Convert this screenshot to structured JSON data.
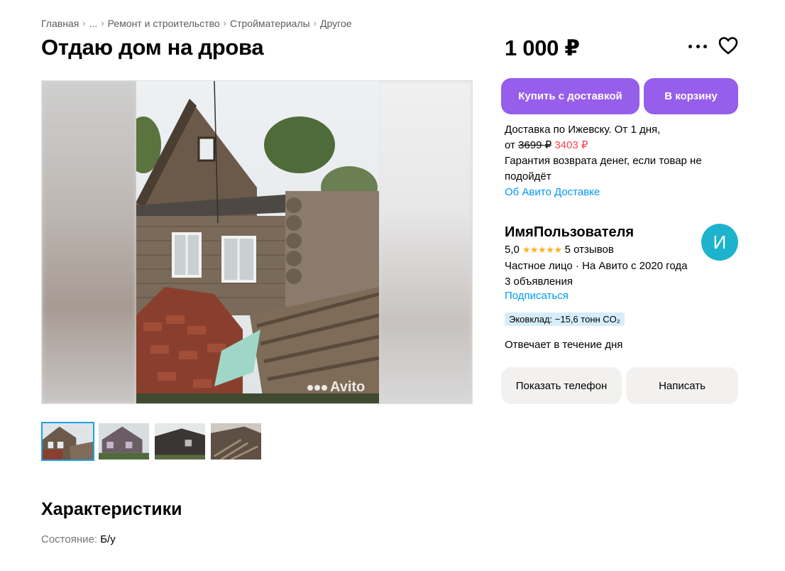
{
  "breadcrumb": {
    "items": [
      "Главная",
      "...",
      "Ремонт и строительство",
      "Стройматериалы",
      "Другое"
    ],
    "separator": "›"
  },
  "title": "Отдаю дом на дрова",
  "gallery": {
    "watermark": "Avito",
    "thumbnail_count": 4,
    "active_thumbnail": 1
  },
  "characteristics": {
    "heading": "Характеристики",
    "condition_label": "Состояние:",
    "condition_value": "Б/у"
  },
  "price": "1 000 ₽",
  "actions": {
    "buy_with_delivery": "Купить с доставкой",
    "add_to_cart": "В корзину",
    "more_icon": "more-dots-icon",
    "favorite_icon": "heart-icon"
  },
  "delivery": {
    "line1": "Доставка по Ижевску. От 1 дня,",
    "from_prefix": "от",
    "old_price": "3699 ₽",
    "new_price": "3403 ₽",
    "guarantee": "Гарантия возврата денег, если товар не подойдёт",
    "about_link": "Об Авито Доставке"
  },
  "seller": {
    "name": "ИмяПользователя",
    "rating": "5,0",
    "stars": "★★★★★",
    "reviews": "5 отзывов",
    "info": "Частное лицо · На Авито с 2020 года",
    "listings": "3 объявления",
    "subscribe": "Подписаться",
    "eco_badge": "Эковклад: −15,6 тонн CO₂",
    "avatar_letter": "И",
    "response_time": "Отвечает в течение дня"
  },
  "contact": {
    "show_phone": "Показать телефон",
    "write": "Написать"
  },
  "colors": {
    "accent_purple": "#965eeb",
    "link_blue": "#0099f7",
    "sale_red": "#ff4053",
    "star_yellow": "#ffb021",
    "avatar_teal": "#1eb3cc"
  }
}
